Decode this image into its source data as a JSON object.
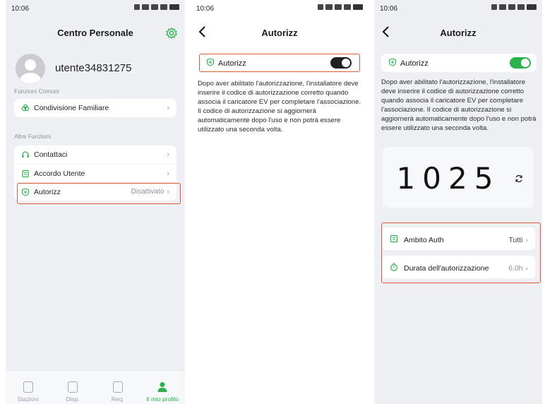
{
  "panel1": {
    "status_time": "10:06",
    "title": "Centro Personale",
    "username": "utente34831275",
    "section_common": "Funzioni Comuni",
    "family_label": "Condivisione Familiare",
    "section_other": "Altre Funzioni",
    "contact_label": "Contattaci",
    "agreement_label": "Accordo Utente",
    "auth_label": "Autorizz",
    "auth_value": "Disattivato",
    "tabs": [
      "Stazioni",
      "Disp.",
      "Req.",
      "Il mio profilo"
    ]
  },
  "panel2": {
    "status_time": "10:06",
    "title": "Autorizz",
    "auth_label": "Autorizz",
    "toggle_on": false,
    "description": "Dopo aver abilitato l'autorizzazione, l'installatore deve inserire il codice di autorizzazione corretto quando associa il caricatore EV per completare l'associazione. Il codice di autorizzazione si aggiornerà automaticamente dopo l'uso e non potrà essere utilizzato una seconda volta."
  },
  "panel3": {
    "status_time": "10:06",
    "title": "Autorizz",
    "auth_label": "Autorizz",
    "toggle_on": true,
    "description": "Dopo aver abilitato l'autorizzazione, l'installatore deve inserire il codice di autorizzazione corretto quando associa il caricatore EV per completare l'associazione. Il codice di autorizzazione si aggiornerà automaticamente dopo l'uso e non potrà essere utilizzato una seconda volta.",
    "auth_code": "1025",
    "scope_label": "Ambito Auth",
    "scope_value": "Tutti",
    "duration_label": "Durata dell'autorizzazione",
    "duration_value": "6.0h"
  },
  "colors": {
    "accent_green": "#2bb24c",
    "highlight_red": "#e05a3f",
    "toggle_off": "#1f1f1f"
  },
  "icons": [
    "gear-icon",
    "back-arrow-icon",
    "family-share-icon",
    "headset-icon",
    "document-icon",
    "shield-icon",
    "station-icon",
    "device-icon",
    "request-icon",
    "profile-icon",
    "refresh-icon",
    "scope-icon",
    "timer-icon",
    "chevron-right-icon"
  ]
}
